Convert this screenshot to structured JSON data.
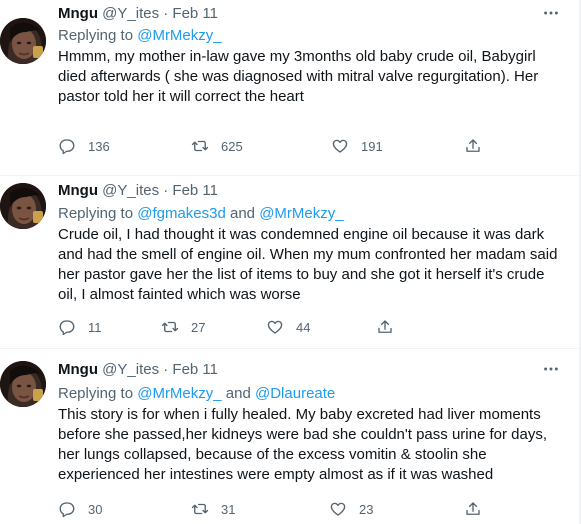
{
  "tweets": [
    {
      "name": "Mngu",
      "handle": "@Y_ites",
      "dot": "·",
      "date": "Feb 11",
      "replying_prefix": "Replying to ",
      "replying_users": [
        "@MrMekzy_"
      ],
      "replying_joiner": "",
      "lines": [
        "Hmmm, my mother in-law gave my 3months old baby crude oil, Babygirl",
        "died afterwards ( she was diagnosed with mitral valve regurgitation). Her",
        "pastor told her it will correct the heart"
      ],
      "replies": "136",
      "retweets": "625",
      "likes": "191"
    },
    {
      "name": "Mngu",
      "handle": "@Y_ites",
      "dot": "·",
      "date": "Feb 11",
      "replying_prefix": "Replying to ",
      "replying_users": [
        "@fgmakes3d",
        "@MrMekzy_"
      ],
      "replying_joiner": " and ",
      "lines": [
        "Crude oil, I had thought it was condemned engine oil because it was dark",
        "and had the smell of engine oil. When my mum confronted her madam said",
        "her pastor gave her the list of items to buy and she got it herself it's crude",
        "oil, I almost fainted which was worse"
      ],
      "replies": "11",
      "retweets": "27",
      "likes": "44"
    },
    {
      "name": "Mngu",
      "handle": "@Y_ites",
      "dot": "·",
      "date": "Feb 11",
      "replying_prefix": "Replying to ",
      "replying_users": [
        "@MrMekzy_",
        "@Dlaureate"
      ],
      "replying_joiner": " and ",
      "lines": [
        "This story is for when i fully healed. My baby excreted had liver moments",
        "before she passed,her kidneys were bad she couldn't pass urine for days,",
        "her lungs collapsed, because of the excess vomitin & stoolin she",
        "experienced her intestines were empty almost as if it was washed"
      ],
      "replies": "30",
      "retweets": "31",
      "likes": "23"
    }
  ],
  "colors": {
    "text": "#0f1419",
    "secondary": "#536471",
    "link": "#1d9bf0",
    "divider": "#eff3f4"
  },
  "icons": {
    "more": "more-horizontal-icon",
    "reply": "reply-icon",
    "retweet": "retweet-icon",
    "like": "heart-icon",
    "share": "share-icon"
  }
}
